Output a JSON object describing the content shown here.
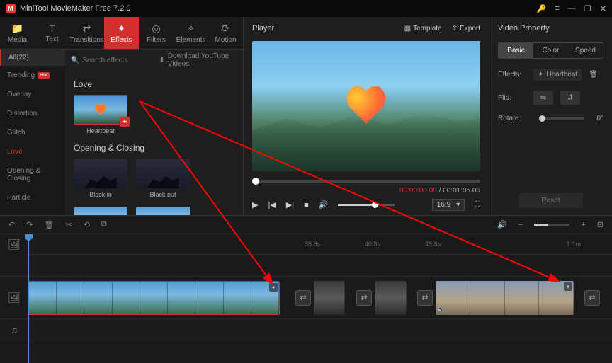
{
  "title": "MiniTool MovieMaker Free 7.2.0",
  "topTabs": {
    "media": "Media",
    "text": "Text",
    "transitions": "Transitions",
    "effects": "Effects",
    "filters": "Filters",
    "elements": "Elements",
    "motion": "Motion"
  },
  "sidebar": {
    "all": "All(22)",
    "items": [
      "Trending",
      "Overlay",
      "Distortion",
      "Glitch",
      "Love",
      "Opening & Closing",
      "Particle"
    ],
    "hot": "Hot"
  },
  "search": {
    "placeholder": "Search effects",
    "download": "Download YouTube Videos"
  },
  "sections": {
    "love": "Love",
    "opening": "Opening & Closing"
  },
  "effects": {
    "heartbeat": "Heartbeat",
    "blackin": "Black in",
    "blackout": "Black out"
  },
  "player": {
    "title": "Player",
    "template": "Template",
    "export": "Export",
    "timeCur": "00:00:00.00",
    "timeTotal": " / 00:01:05.06",
    "aspect": "16:9"
  },
  "property": {
    "title": "Video Property",
    "tabs": {
      "basic": "Basic",
      "color": "Color",
      "speed": "Speed"
    },
    "effectsLabel": "Effects:",
    "effectName": "Heartbeat",
    "flip": "Flip:",
    "rotate": "Rotate:",
    "rotateVal": "0°",
    "reset": "Reset"
  },
  "ruler": {
    "m1": "35.8s",
    "m2": "40.8s",
    "m3": "45.8s",
    "m4": "1.1m"
  },
  "icons": {
    "media": "📁",
    "text": "T",
    "transitions": "⇄",
    "effects": "✦",
    "filters": "◎",
    "elements": "✧",
    "motion": "⟳",
    "search": "🔍",
    "download": "⬇",
    "play": "▶",
    "prev": "|◀",
    "next": "▶|",
    "stop": "■",
    "vol": "🔊",
    "full": "⛶",
    "img": "🖼",
    "del": "🗑",
    "trash": "🗑",
    "chevron": "▾",
    "plus": "+",
    "flip_h": "⇋",
    "flip_v": "⇵",
    "speaker": "🔈",
    "undo": "↶",
    "redo": "↷",
    "cut": "✂",
    "refresh": "⟲",
    "crop": "⧉",
    "minus": "−",
    "fit": "⊡",
    "music": "♫",
    "menu": "≡",
    "min": "—",
    "max": "❐",
    "close": "✕",
    "key": "🔑",
    "transition": "⇄",
    "template": "▦",
    "export": "⇧"
  }
}
